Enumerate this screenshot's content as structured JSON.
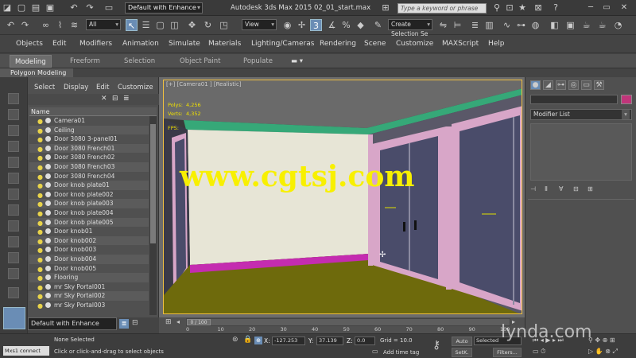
{
  "app": {
    "title": "Autodesk 3ds Max  2015     02_01_start.max",
    "workspace": "Default with Enhance",
    "search_placeholder": "Type a keyword or phrase"
  },
  "toolbar": {
    "selection_filter": "All",
    "ref_coord": "View",
    "named_sel": "Create Selection Se"
  },
  "menu": [
    "Objects",
    "Edit",
    "Modifiers",
    "Animation",
    "Simulate",
    "Materials",
    "Lighting/Cameras",
    "Rendering",
    "Scene",
    "Customize",
    "MAXScript",
    "Help"
  ],
  "ribbon": {
    "tabs": [
      "Modeling",
      "Freeform",
      "Selection",
      "Object Paint",
      "Populate"
    ],
    "active": "Modeling",
    "panel": "Polygon Modeling"
  },
  "explorer": {
    "menu": [
      "Select",
      "Display",
      "Edit",
      "Customize"
    ],
    "column": "Name",
    "items": [
      "Camera01",
      "Ceiling",
      "Door 3080 3-panel01",
      "Door 3080 French01",
      "Door 3080 French02",
      "Door 3080 French03",
      "Door 3080 French04",
      "Door knob plate01",
      "Door knob plate002",
      "Door knob plate003",
      "Door knob plate004",
      "Door knob plate005",
      "Door knob01",
      "Door knob002",
      "Door knob003",
      "Door knob004",
      "Door knob005",
      "Flooring",
      "mr Sky Portal001",
      "mr Sky Portal002",
      "mr Sky Portal003"
    ],
    "layer_combo": "Default with Enhance"
  },
  "viewport": {
    "label": "[+] [Camera01 ] [Realistic]",
    "stats": [
      "Polys:",
      "Verts:",
      "FPS:"
    ],
    "poly_count": "4,256",
    "vert_count": "4,352",
    "watermark": "www.cgtsj.com",
    "colors": {
      "ceiling": "#6a6a6a",
      "back_wall": "#e7e5d6",
      "side_wall": "#5a5868",
      "floor": "#6e6a0c",
      "trim": "#c42cb0",
      "molding": "#36a878",
      "door_frame": "#d8a6c8",
      "glass": "#4a4c6a"
    }
  },
  "timeline": {
    "frame": "0 / 100",
    "ticks": [
      "0",
      "10",
      "20",
      "30",
      "40",
      "50",
      "60",
      "70",
      "80",
      "90",
      "100"
    ]
  },
  "command_panel": {
    "modifier_list": "Modifier List",
    "swatch_color": "#c0357a"
  },
  "status": {
    "maxscript": "Mxs1 connect 'ter",
    "selection": "None Selected",
    "prompt": "Click or click-and-drag to select objects",
    "x": "-127.253",
    "y": "37.139",
    "z": "0.0",
    "grid": "Grid = 10.0",
    "add_time_tag": "Add time tag",
    "auto": "Auto",
    "set_key": "SetK.",
    "key_mode": "Selected",
    "filters": "Filters..."
  },
  "brand_watermark": "lynda.com"
}
